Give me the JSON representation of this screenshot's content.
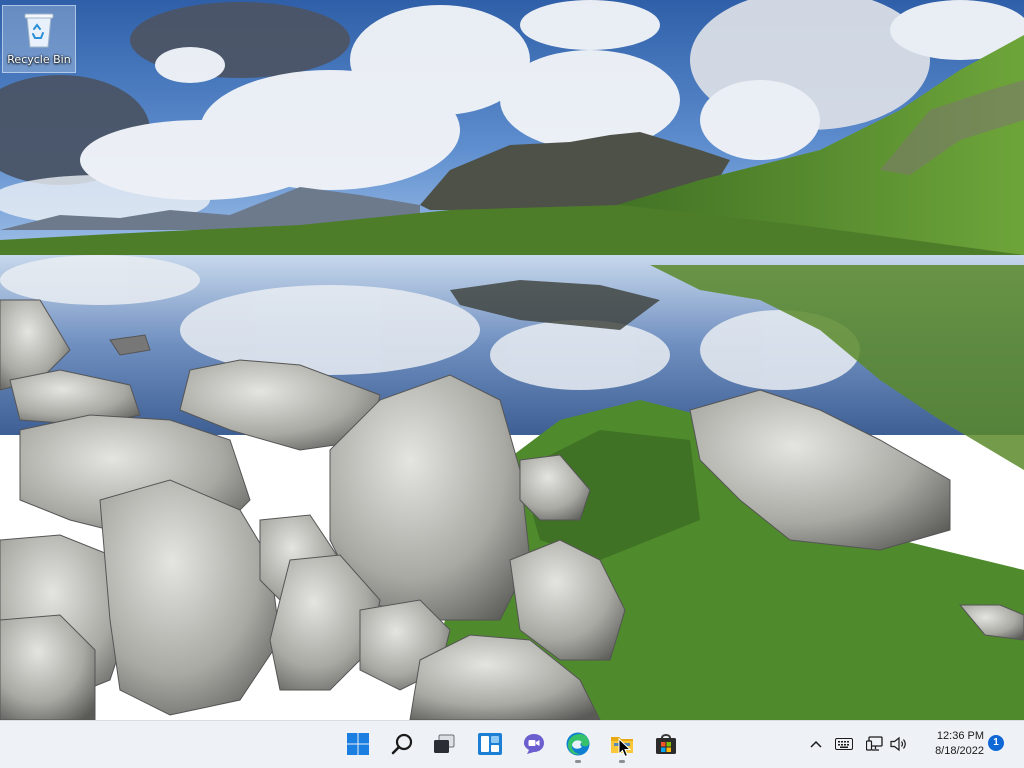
{
  "desktop": {
    "icons": [
      {
        "label": "Recycle Bin",
        "icon": "recycle-bin-icon"
      }
    ]
  },
  "taskbar": {
    "apps": [
      {
        "name": "Start",
        "icon": "windows-start-icon"
      },
      {
        "name": "Search",
        "icon": "search-icon"
      },
      {
        "name": "Task View",
        "icon": "task-view-icon"
      },
      {
        "name": "Widgets",
        "icon": "widgets-icon"
      },
      {
        "name": "Chat",
        "icon": "chat-icon"
      },
      {
        "name": "Microsoft Edge",
        "icon": "edge-icon"
      },
      {
        "name": "File Explorer",
        "icon": "file-explorer-icon"
      },
      {
        "name": "Microsoft Store",
        "icon": "store-icon"
      }
    ],
    "tray": {
      "icons": [
        "chevron-up-icon",
        "keyboard-icon",
        "network-icon",
        "volume-icon"
      ],
      "time": "12:36 PM",
      "date": "8/18/2022",
      "notification_count": "1"
    }
  },
  "colors": {
    "taskbar_bg": "#eef1f5",
    "accent": "#1067d6",
    "start_blue": "#1a7fe0"
  }
}
